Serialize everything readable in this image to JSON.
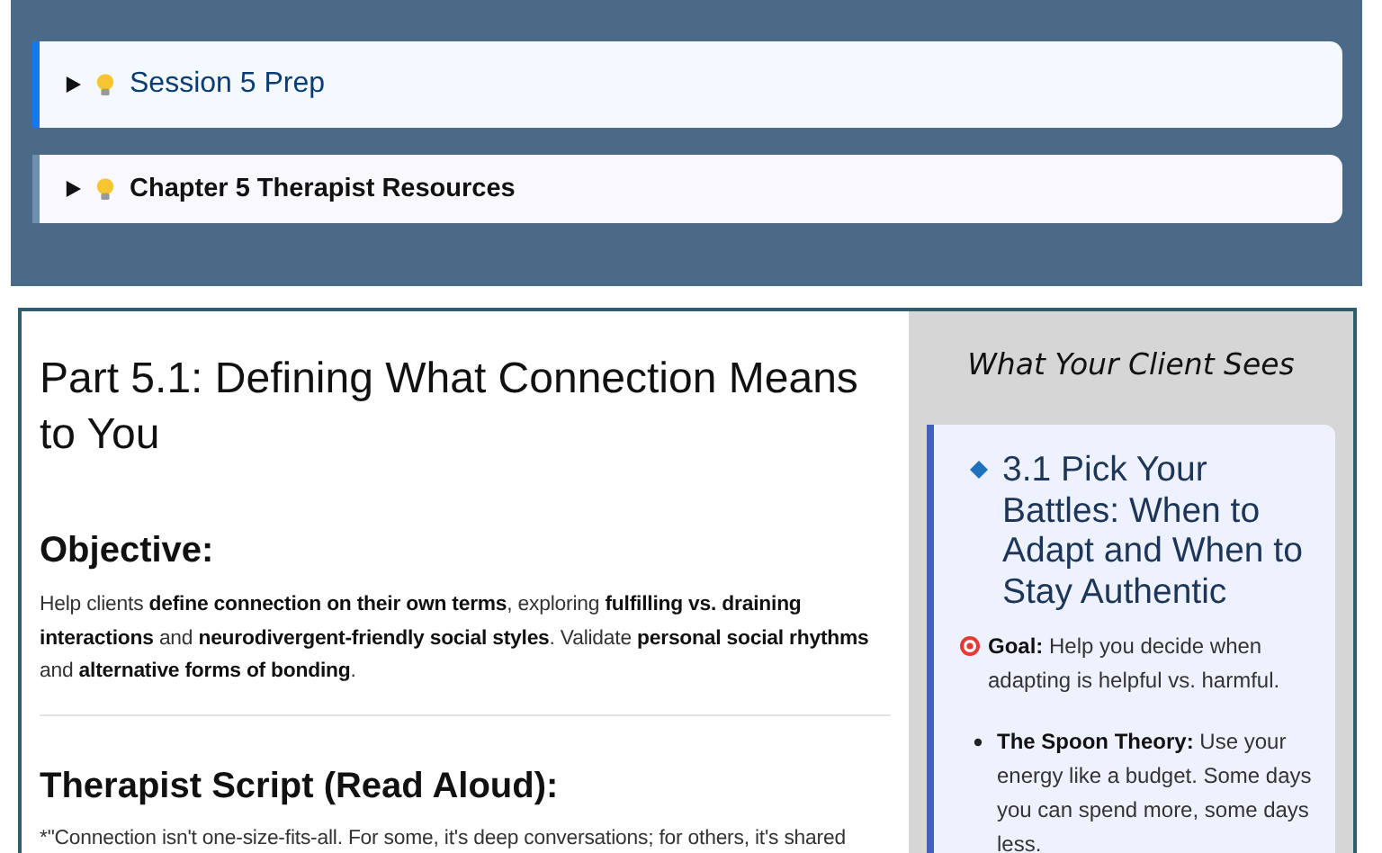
{
  "sections": [
    {
      "title": "Session 5 Prep",
      "expanded": false,
      "selected": true
    },
    {
      "title": "Chapter 5 Therapist Resources",
      "expanded": false,
      "selected": false
    }
  ],
  "main": {
    "title": "Part 5.1: Defining What Connection Means to You",
    "objective": {
      "heading": "Objective:",
      "text": "Help clients **define connection on their own terms**, exploring **fulfilling vs. draining interactions** and **neurodivergent-friendly social styles**. Validate **personal social rhythms** and **alternative forms of bonding**."
    },
    "script": {
      "heading": "Therapist Script (Read Aloud):",
      "text": "*\"Connection isn't one-size-fits-all. For some, it's deep conversations; for others, it's shared"
    }
  },
  "client_view": {
    "heading": "What Your Client Sees",
    "card": {
      "title": "3.1 Pick Your Battles: When to Adapt and When to Stay Authentic",
      "goal": "**Goal:** Help you decide when adapting is helpful vs. harmful.",
      "bullets": [
        "**The Spoon Theory:** Use your energy like a budget. Some days you can spend more, some days less."
      ]
    }
  }
}
